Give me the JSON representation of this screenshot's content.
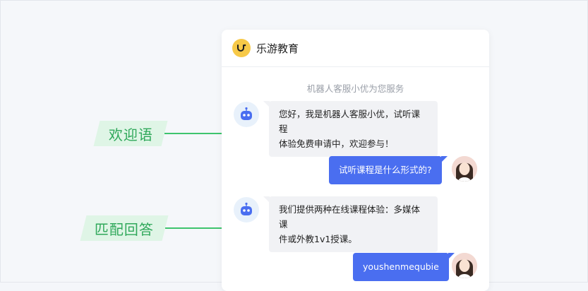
{
  "app": {
    "title": "乐游教育"
  },
  "intro_text": "机器人客服小优为您服务",
  "messages": [
    {
      "side": "bot",
      "line1": "您好，我是机器人客服小优，试听课程",
      "line2": "体验免费申请中，欢迎参与！"
    },
    {
      "side": "user",
      "text": "试听课程是什么形式的?"
    },
    {
      "side": "bot",
      "line1": "我们提供两种在线课程体验：多媒体课",
      "line2": "件或外教1v1授课。"
    },
    {
      "side": "user",
      "text": "youshenmequbie"
    }
  ],
  "annotations": [
    {
      "label": "欢迎语"
    },
    {
      "label": "匹配回答"
    }
  ],
  "colors": {
    "accent_blue": "#4a6ef0",
    "accent_green": "#3ec46d",
    "logo_yellow": "#f7c948"
  }
}
